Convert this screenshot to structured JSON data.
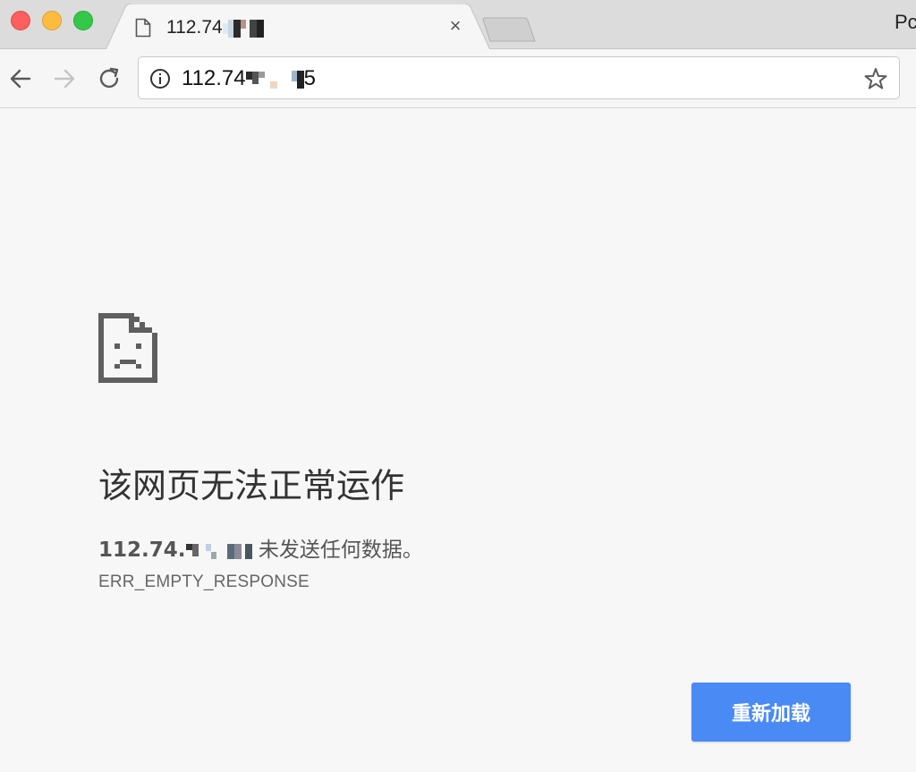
{
  "browser": {
    "tab": {
      "title_visible": "112.74",
      "close_glyph": "×",
      "icon": "page-icon"
    },
    "profile_label": "Pc",
    "toolbar": {
      "back_icon": "back-arrow-icon",
      "forward_icon": "forward-arrow-icon",
      "reload_icon": "reload-icon",
      "url_visible_prefix": "112.74",
      "url_visible_suffix": "5",
      "info_icon": "info-icon",
      "bookmark_icon": "star-icon"
    }
  },
  "error_page": {
    "icon": "sad-page-icon",
    "heading": "该网页无法正常运作",
    "detail_host_prefix": "112.74.",
    "detail_message": "未发送任何数据。",
    "error_code": "ERR_EMPTY_RESPONSE",
    "reload_button_label": "重新加载"
  },
  "colors": {
    "accent_button": "#4a8af4",
    "traffic_red": "#fc605c",
    "traffic_yellow": "#fdbc40",
    "traffic_green": "#34c84a"
  }
}
